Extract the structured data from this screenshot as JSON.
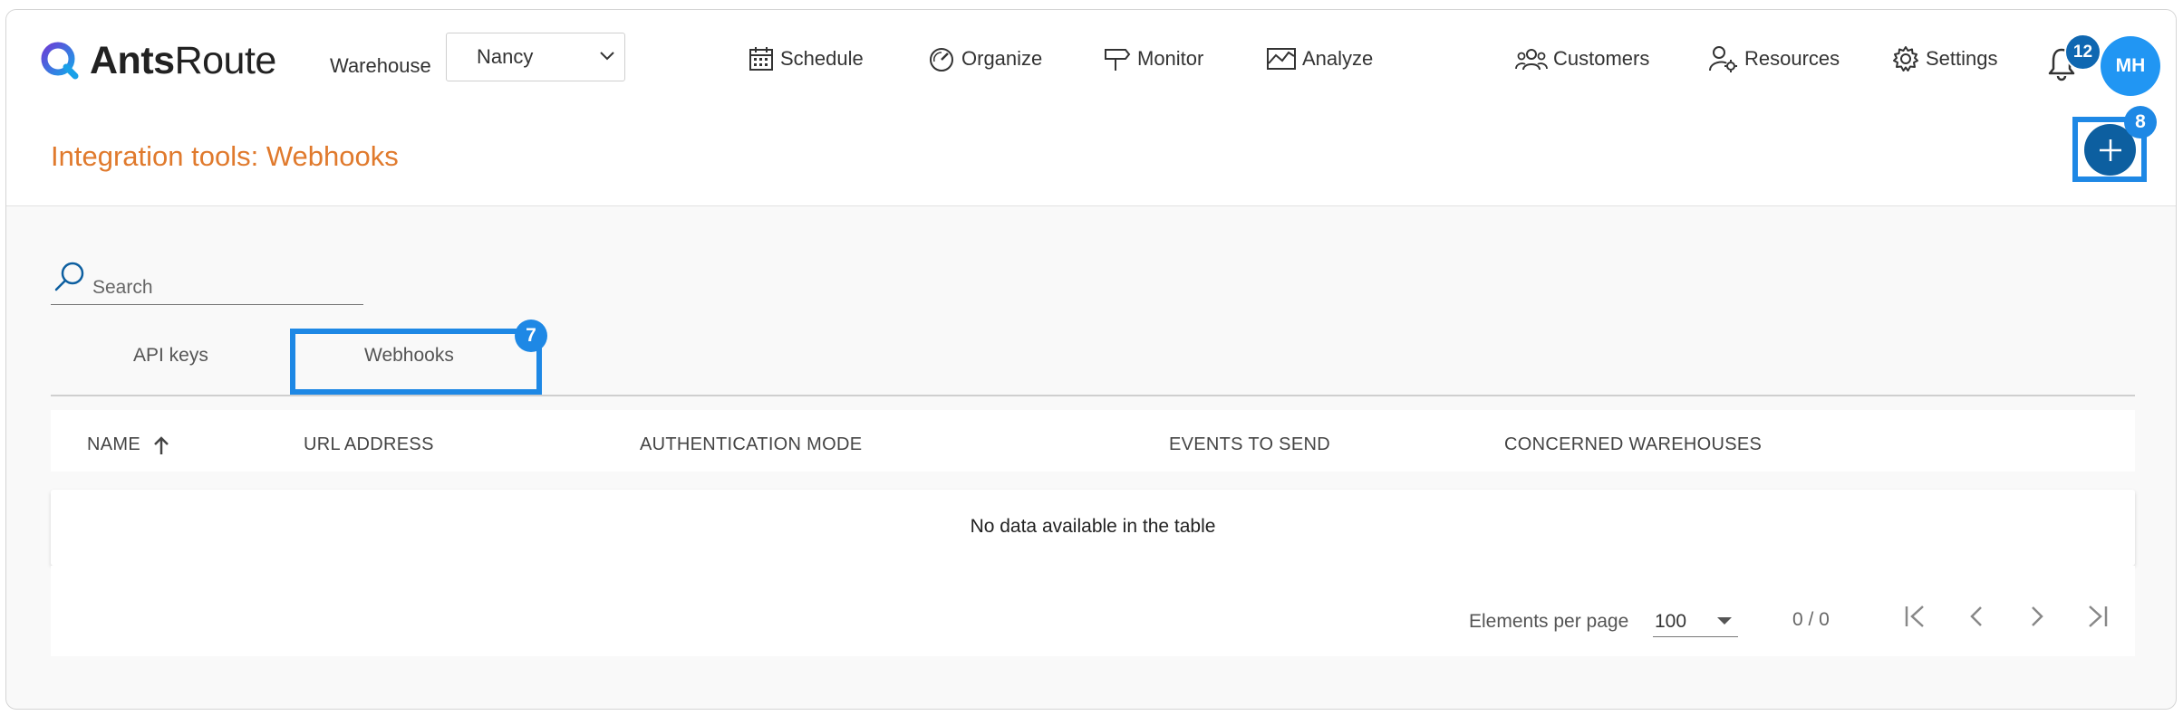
{
  "app": {
    "logo_bold": "Ants",
    "logo_regular": "Route"
  },
  "header": {
    "warehouse_label": "Warehouse",
    "warehouse_value": "Nancy",
    "nav": {
      "schedule": "Schedule",
      "organize": "Organize",
      "monitor": "Monitor",
      "analyze": "Analyze",
      "customers": "Customers",
      "resources": "Resources",
      "settings": "Settings"
    },
    "notification_count": "12",
    "avatar_initials": "MH"
  },
  "page": {
    "title": "Integration tools: Webhooks",
    "add_badge": "8"
  },
  "search": {
    "placeholder": "Search"
  },
  "tabs": {
    "api_keys": "API keys",
    "webhooks": "Webhooks",
    "webhooks_badge": "7"
  },
  "table": {
    "columns": {
      "name": "NAME",
      "url": "URL ADDRESS",
      "auth": "AUTHENTICATION MODE",
      "events": "EVENTS TO SEND",
      "warehouses": "CONCERNED WAREHOUSES"
    },
    "empty_message": "No data available in the table"
  },
  "pagination": {
    "per_page_label": "Elements per page",
    "per_page_value": "100",
    "range": "0 / 0"
  },
  "colors": {
    "accent": "#e07a2d",
    "primary": "#0d5fa0",
    "highlight": "#1e88e5"
  }
}
